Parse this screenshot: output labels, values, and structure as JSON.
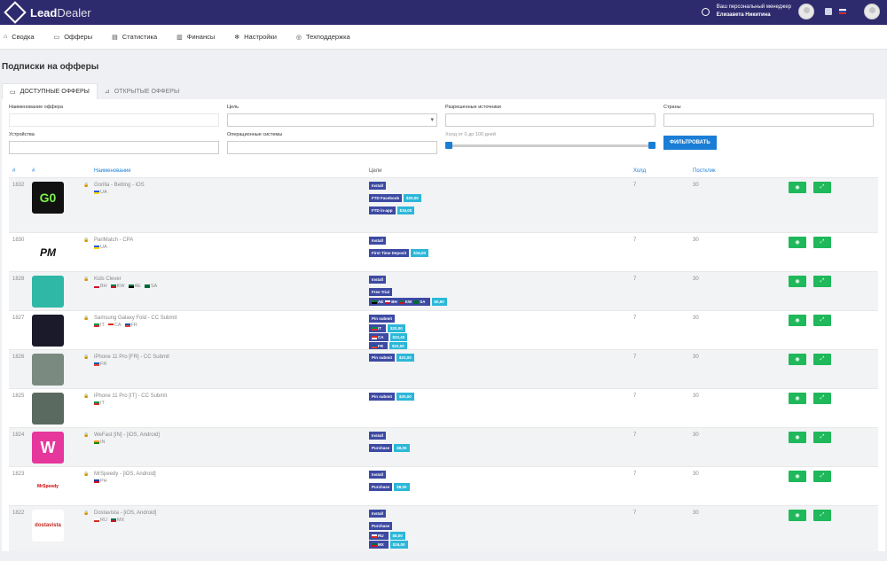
{
  "brand": {
    "name_bold": "Lead",
    "name_light": "Dealer"
  },
  "manager": {
    "label": "Ваш персональный менеджер",
    "name": "Елизавета Никитина"
  },
  "nav": [
    {
      "label": "Сводка",
      "icon": "home-icon"
    },
    {
      "label": "Офферы",
      "icon": "folder-icon"
    },
    {
      "label": "Статистика",
      "icon": "chart-icon"
    },
    {
      "label": "Финансы",
      "icon": "wallet-icon"
    },
    {
      "label": "Настройки",
      "icon": "gear-icon"
    },
    {
      "label": "Техподдержка",
      "icon": "lifebuoy-icon"
    }
  ],
  "page_title": "Подписки на офферы",
  "tabs": {
    "available": "ДОСТУПНЫЕ ОФФЕРЫ",
    "open": "ОТКРЫТЫЕ ОФФЕРЫ"
  },
  "filters": {
    "offer_name": "Наименование оффера",
    "goal": "Цель",
    "sources": "Разрешенные источники",
    "countries": "Страны",
    "devices": "Устройства",
    "os": "Операционные системы",
    "hold": "Холд от 0 до 100 дней",
    "hold_range": [
      0,
      100
    ],
    "button": "ФИЛЬТРОВАТЬ"
  },
  "columns": {
    "num1": "#",
    "num2": "#",
    "name": "Наименование",
    "goals": "Цели",
    "hold": "Холд",
    "postclick": "Постклик"
  },
  "colors": {
    "topbar": "#2e2a6e",
    "accent": "#1a7ed6",
    "goal_badge": "#3d4aa3",
    "price_badge": "#2bb7d8",
    "action": "#1fb85a"
  },
  "rows": [
    {
      "id": "1832",
      "name": "Gorilla - Betting - iOS",
      "geo": [
        "UA"
      ],
      "hold": "7",
      "post": "30",
      "goals": [
        {
          "label": "Install"
        },
        {
          "label": "FTD Facebook",
          "price": "$20,00"
        },
        {
          "label": "FTD in-app",
          "price": "$16,00"
        }
      ]
    },
    {
      "id": "1830",
      "name": "PariMatch - CPA",
      "geo": [
        "UA"
      ],
      "hold": "7",
      "post": "30",
      "goals": [
        {
          "label": "Install"
        },
        {
          "label": "First Time Deposit",
          "price": "$16,00"
        }
      ]
    },
    {
      "id": "1828",
      "name": "Kids Clever",
      "geo": [
        "BH",
        "KW",
        "AE",
        "SA"
      ],
      "hold": "7",
      "post": "30",
      "goals": [
        {
          "label": "Install"
        },
        {
          "label": "Free Trial",
          "subs": [
            {
              "flags": [
                "AE",
                "BH",
                "KW",
                "SA"
              ],
              "price": "$0,90"
            }
          ]
        }
      ]
    },
    {
      "id": "1827",
      "name": "Samsung Galaxy Fold - CC Submit",
      "geo": [
        "IT",
        "CA",
        "FR"
      ],
      "hold": "7",
      "post": "30",
      "goals": [
        {
          "label": "Pin submit",
          "subs": [
            {
              "flags": [
                "IT"
              ],
              "price": "$20,00"
            },
            {
              "flags": [
                "CA"
              ],
              "price": "$22,40"
            },
            {
              "flags": [
                "FR"
              ],
              "price": "$22,00"
            }
          ]
        }
      ]
    },
    {
      "id": "1826",
      "name": "iPhone 11 Pro [FR] - CC Submit",
      "geo": [
        "FR"
      ],
      "hold": "7",
      "post": "30",
      "goals": [
        {
          "label": "Pin submit",
          "price": "$22,00"
        }
      ]
    },
    {
      "id": "1825",
      "name": "iPhone 11 Pro [IT] - CC Submit",
      "geo": [
        "IT"
      ],
      "hold": "7",
      "post": "30",
      "goals": [
        {
          "label": "Pin submit",
          "price": "$20,00"
        }
      ]
    },
    {
      "id": "1824",
      "name": "WeFast [IN] - [iOS, Android]",
      "geo": [
        "IN"
      ],
      "hold": "7",
      "post": "30",
      "goals": [
        {
          "label": "Install"
        },
        {
          "label": "Purchase",
          "price": "$8,00"
        }
      ]
    },
    {
      "id": "1823",
      "name": "MrSpeedy - [iOS, Android]",
      "geo": [
        "PH"
      ],
      "hold": "7",
      "post": "30",
      "goals": [
        {
          "label": "Install"
        },
        {
          "label": "Purchase",
          "price": "$8,00"
        }
      ]
    },
    {
      "id": "1822",
      "name": "Dostavista - [iOS, Android]",
      "geo": [
        "RU",
        "MX"
      ],
      "hold": "7",
      "post": "30",
      "goals": [
        {
          "label": "Install"
        },
        {
          "label": "Purchase",
          "subs": [
            {
              "flags": [
                "RU"
              ],
              "price": "$8,00"
            },
            {
              "flags": [
                "MX"
              ],
              "price": "$16,00"
            }
          ]
        }
      ]
    }
  ],
  "app_logos": {
    "1832": "G0",
    "1830": "PM",
    "1824": "W",
    "1823": "MrSpeedy",
    "1822": "dostavista"
  }
}
